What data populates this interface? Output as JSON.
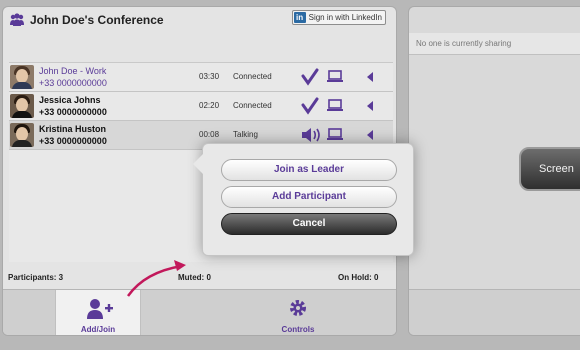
{
  "conference": {
    "title": "John Doe's Conference"
  },
  "linkedin": {
    "logo": "in",
    "label": "Sign in with LinkedIn"
  },
  "participants": [
    {
      "name": "John Doe - Work",
      "number": "+33 0000000000",
      "time": "03:30",
      "status": "Connected",
      "state_icon": "check-icon",
      "is_self": true
    },
    {
      "name": "Jessica Johns",
      "number": "+33 0000000000",
      "time": "02:20",
      "status": "Connected",
      "state_icon": "check-icon",
      "is_self": false
    },
    {
      "name": "Kristina Huston",
      "number": "+33 0000000000",
      "time": "00:08",
      "status": "Talking",
      "state_icon": "speaker-icon",
      "is_self": false
    }
  ],
  "stats": {
    "participants": "Participants: 3",
    "muted": "Muted: 0",
    "on_hold": "On Hold: 0"
  },
  "nav": {
    "add_join": "Add/Join",
    "controls": "Controls"
  },
  "sharing": {
    "status_text": "No one is currently sharing",
    "screen_button": "Screen"
  },
  "popup": {
    "join_leader": "Join as Leader",
    "add_participant": "Add Participant",
    "cancel": "Cancel"
  },
  "colors": {
    "accent": "#5a3b98",
    "annotation": "#c2185b"
  }
}
